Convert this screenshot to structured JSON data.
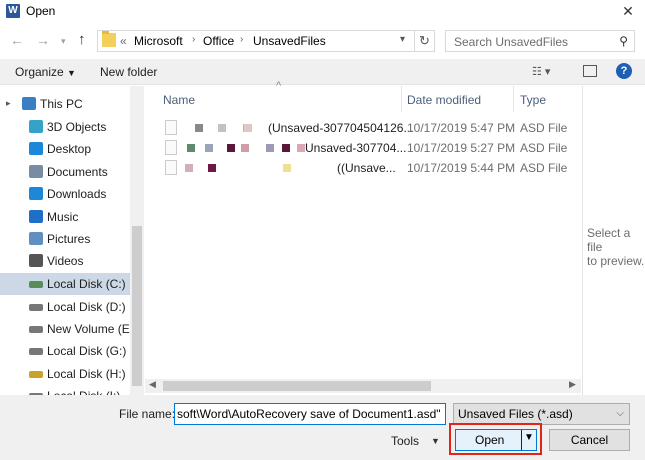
{
  "window": {
    "title": "Open",
    "app_icon_letter": "W"
  },
  "address": {
    "crumbs": [
      "Microsoft",
      "Office",
      "UnsavedFiles"
    ],
    "overflow": "«",
    "search_placeholder": "Search UnsavedFiles"
  },
  "toolbar": {
    "organize_label": "Organize",
    "new_folder_label": "New folder"
  },
  "nav": {
    "items": [
      {
        "label": "This PC",
        "icon": "computer-icon",
        "color": "#3a7fc1"
      },
      {
        "label": "3D Objects",
        "icon": "cube-icon",
        "color": "#34a2c9"
      },
      {
        "label": "Desktop",
        "icon": "desktop-icon",
        "color": "#1e88d8"
      },
      {
        "label": "Documents",
        "icon": "document-icon",
        "color": "#7a8ca3"
      },
      {
        "label": "Downloads",
        "icon": "download-icon",
        "color": "#1e88d8"
      },
      {
        "label": "Music",
        "icon": "music-icon",
        "color": "#1e6fc8"
      },
      {
        "label": "Pictures",
        "icon": "pictures-icon",
        "color": "#5f90c0"
      },
      {
        "label": "Videos",
        "icon": "video-icon",
        "color": "#555555"
      },
      {
        "label": "Local Disk (C:)",
        "icon": "drive-icon",
        "color": "#5a8c5a"
      },
      {
        "label": "Local Disk (D:)",
        "icon": "drive-icon",
        "color": "#777777"
      },
      {
        "label": "New Volume (E:)",
        "icon": "drive-icon",
        "color": "#777777"
      },
      {
        "label": "Local Disk (G:)",
        "icon": "drive-icon",
        "color": "#777777"
      },
      {
        "label": "Local Disk (H:)",
        "icon": "drive-lock-icon",
        "color": "#c9a227"
      },
      {
        "label": "Local Disk (I:)",
        "icon": "drive-icon",
        "color": "#777777"
      }
    ],
    "selected_index": 8
  },
  "columns": {
    "name": "Name",
    "date": "Date modified",
    "type": "Type"
  },
  "files": [
    {
      "name": "(Unsaved-307704504126...",
      "date": "10/17/2019 5:47 PM",
      "type": "ASD File"
    },
    {
      "name": "Unsaved-307704...",
      "date": "10/17/2019 5:27 PM",
      "type": "ASD File"
    },
    {
      "name": "((Unsave...",
      "date": "10/17/2019 5:44 PM",
      "type": "ASD File"
    }
  ],
  "preview": {
    "line1": "Select a file",
    "line2": "to preview."
  },
  "bottom": {
    "file_name_label": "File name:",
    "file_name_value": "soft\\Word\\AutoRecovery save of Document1.asd\"",
    "filter_value": "Unsaved Files (*.asd)",
    "tools_label": "Tools",
    "open_label": "Open",
    "cancel_label": "Cancel"
  }
}
